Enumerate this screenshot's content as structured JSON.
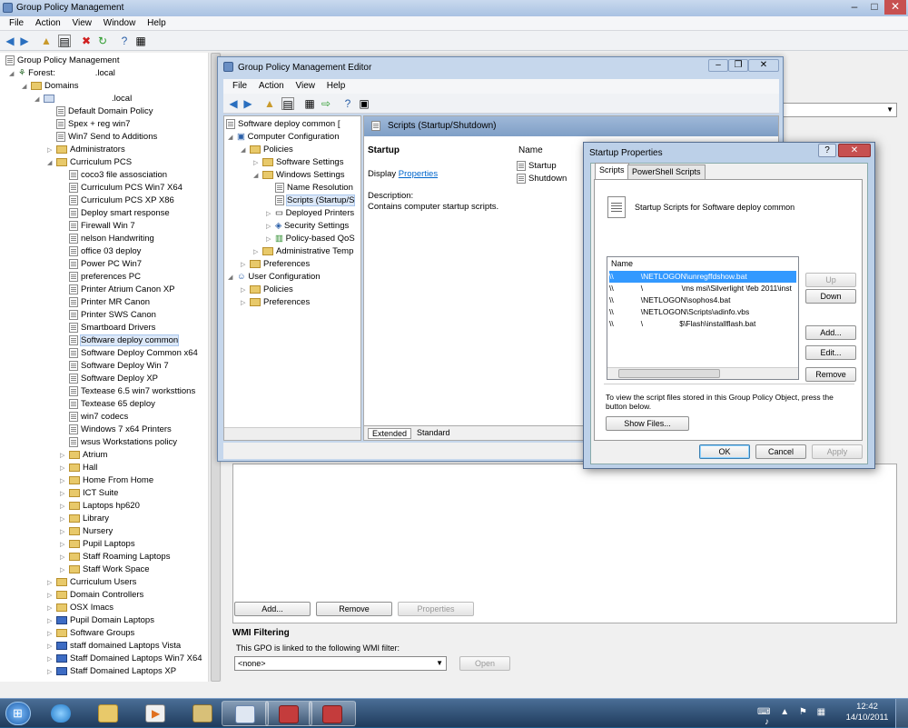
{
  "main": {
    "title": "Group Policy Management",
    "menu": [
      "File",
      "Action",
      "View",
      "Window",
      "Help"
    ],
    "controls": {
      "min": "–",
      "max": "□",
      "close": "✕"
    },
    "tree": {
      "root": "Group Policy Management",
      "forest": "Forest:",
      "forest_domain": ".local",
      "domains": "Domains",
      "domain": ".local",
      "top_gpos": [
        "Default Domain Policy",
        "Spex + reg win7",
        "Win7 Send to Additions"
      ],
      "administrators": "Administrators",
      "curriculum_pcs": "Curriculum PCS",
      "curriculum_gpos": [
        "coco3 file assosciation",
        "Curriculum PCS Win7 X64",
        "Curriculum PCS XP X86",
        "Deploy smart response",
        "Firewall Win 7",
        "nelson Handwriting",
        "office 03 deploy",
        "Power PC Win7",
        "preferences PC",
        "Printer Atrium Canon XP",
        "Printer MR Canon",
        "Printer SWS Canon",
        "Smartboard Drivers",
        "Software deploy common",
        "Software Deploy Common x64",
        "Software Deploy Win 7",
        "Software Deploy XP",
        "Textease 6.5 win7 worksttions",
        "Textease 65 deploy",
        "win7 codecs",
        "Windows 7 x64 Printers",
        "wsus Workstations policy"
      ],
      "curriculum_ous": [
        "Atrium",
        "Hall",
        "Home From Home",
        "ICT Suite",
        "Laptops hp620",
        "Library",
        "Nursery",
        "Pupil Laptops",
        "Staff Roaming Laptops",
        "Staff Work Space"
      ],
      "bottom_ous": [
        "Curriculum Users",
        "Domain Controllers",
        "OSX Imacs",
        "Pupil Domain Laptops",
        "Software Groups",
        "staff domained Laptops Vista",
        "Staff Domained Laptops Win7 X64",
        "Staff Domained Laptops XP"
      ]
    },
    "right": {
      "add": "Add...",
      "remove": "Remove",
      "properties": "Properties",
      "wmi_heading": "WMI Filtering",
      "wmi_text": "This GPO is linked to the following WMI filter:",
      "wmi_value": "<none>",
      "open": "Open"
    }
  },
  "editor": {
    "title": "Group Policy Management Editor",
    "menu": [
      "File",
      "Action",
      "View",
      "Help"
    ],
    "tree": {
      "root": "Software deploy common [",
      "computer": "Computer Configuration",
      "policies": "Policies",
      "software_settings": "Software Settings",
      "windows_settings": "Windows Settings",
      "name_resolution": "Name Resolution",
      "scripts": "Scripts (Startup/S",
      "deployed_printers": "Deployed Printers",
      "security_settings": "Security Settings",
      "qos": "Policy-based QoS",
      "admin_templates": "Administrative Temp",
      "preferences": "Preferences",
      "user": "User Configuration",
      "u_policies": "Policies",
      "u_preferences": "Preferences"
    },
    "header": "Scripts (Startup/Shutdown)",
    "startup": "Startup",
    "display": "Display",
    "properties_link": "Properties",
    "description_label": "Description:",
    "description": "Contains computer startup scripts.",
    "name_col": "Name",
    "items": [
      "Startup",
      "Shutdown"
    ],
    "tabs": [
      "Extended",
      "Standard"
    ]
  },
  "dialog": {
    "title": "Startup Properties",
    "help": "?",
    "close": "✕",
    "tabs": [
      "Scripts",
      "PowerShell Scripts"
    ],
    "heading": "Startup Scripts for Software deploy common",
    "name_col": "Name",
    "scripts": [
      {
        "a": "\\\\",
        "b": "\\NETLOGON\\unregffdshow.bat"
      },
      {
        "a": "\\\\",
        "b": "\\                  \\ms msi\\Silverlight \\feb 2011\\inst"
      },
      {
        "a": "\\\\",
        "b": "\\NETLOGON\\sophos4.bat"
      },
      {
        "a": "\\\\",
        "b": "\\NETLOGON\\Scripts\\adinfo.vbs"
      },
      {
        "a": "\\\\",
        "b": "\\                 $\\Flash\\installflash.bat"
      }
    ],
    "up": "Up",
    "down": "Down",
    "add": "Add...",
    "edit": "Edit...",
    "remove": "Remove",
    "info": "To view the script files stored in this Group Policy Object, press the button below.",
    "show_files": "Show Files...",
    "ok": "OK",
    "cancel": "Cancel",
    "apply": "Apply"
  },
  "taskbar": {
    "time": "12:42",
    "date": "14/10/2011"
  },
  "colors": {
    "selection": "#3399ff",
    "link": "#0066cc"
  }
}
